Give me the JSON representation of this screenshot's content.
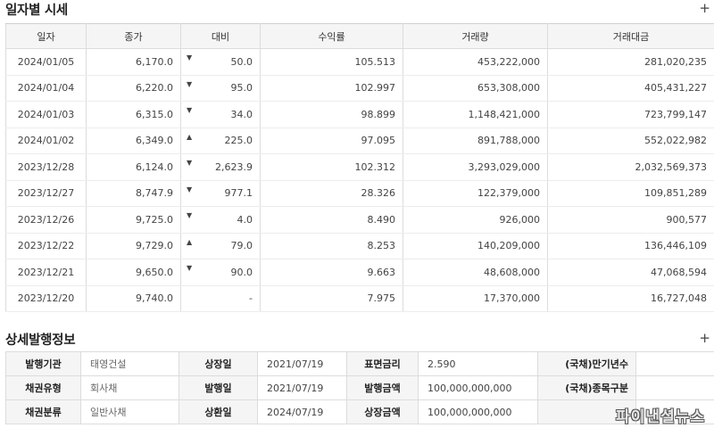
{
  "daily": {
    "title": "일자별 시세",
    "plus": "+",
    "columns": [
      "일자",
      "종가",
      "대비",
      "수익률",
      "거래량",
      "거래대금"
    ],
    "rows": [
      {
        "date": "2024/01/05",
        "close": "6,170.0",
        "dir": "down",
        "arrow": "▼",
        "change": "50.0",
        "yield": "105.513",
        "volume": "453,222,000",
        "amount": "281,020,235"
      },
      {
        "date": "2024/01/04",
        "close": "6,220.0",
        "dir": "down",
        "arrow": "▼",
        "change": "95.0",
        "yield": "102.997",
        "volume": "653,308,000",
        "amount": "405,431,227"
      },
      {
        "date": "2024/01/03",
        "close": "6,315.0",
        "dir": "down",
        "arrow": "▼",
        "change": "34.0",
        "yield": "98.899",
        "volume": "1,148,421,000",
        "amount": "723,799,147"
      },
      {
        "date": "2024/01/02",
        "close": "6,349.0",
        "dir": "up",
        "arrow": "▲",
        "change": "225.0",
        "yield": "97.095",
        "volume": "891,788,000",
        "amount": "552,022,982"
      },
      {
        "date": "2023/12/28",
        "close": "6,124.0",
        "dir": "down",
        "arrow": "▼",
        "change": "2,623.9",
        "yield": "102.312",
        "volume": "3,293,029,000",
        "amount": "2,032,569,373"
      },
      {
        "date": "2023/12/27",
        "close": "8,747.9",
        "dir": "down",
        "arrow": "▼",
        "change": "977.1",
        "yield": "28.326",
        "volume": "122,379,000",
        "amount": "109,851,289"
      },
      {
        "date": "2023/12/26",
        "close": "9,725.0",
        "dir": "down",
        "arrow": "▼",
        "change": "4.0",
        "yield": "8.490",
        "volume": "926,000",
        "amount": "900,577"
      },
      {
        "date": "2023/12/22",
        "close": "9,729.0",
        "dir": "up",
        "arrow": "▲",
        "change": "79.0",
        "yield": "8.253",
        "volume": "140,209,000",
        "amount": "136,446,109"
      },
      {
        "date": "2023/12/21",
        "close": "9,650.0",
        "dir": "down",
        "arrow": "▼",
        "change": "90.0",
        "yield": "9.663",
        "volume": "48,608,000",
        "amount": "47,068,594"
      },
      {
        "date": "2023/12/20",
        "close": "9,740.0",
        "dir": "flat",
        "arrow": "",
        "change": "-",
        "yield": "7.975",
        "volume": "17,370,000",
        "amount": "16,727,048"
      }
    ]
  },
  "detail": {
    "title": "상세발행정보",
    "plus": "+",
    "rows": [
      [
        {
          "label": "발행기관",
          "value": "태영건설"
        },
        {
          "label": "상장일",
          "value": "2021/07/19"
        },
        {
          "label": "표면금리",
          "value": "2.590"
        },
        {
          "label": "(국채)만기년수",
          "value": ""
        }
      ],
      [
        {
          "label": "채권유형",
          "value": "회사채"
        },
        {
          "label": "발행일",
          "value": "2021/07/19"
        },
        {
          "label": "발행금액",
          "value": "100,000,000,000"
        },
        {
          "label": "(국채)종목구분",
          "value": ""
        }
      ],
      [
        {
          "label": "채권분류",
          "value": "일반사채"
        },
        {
          "label": "상환일",
          "value": "2024/07/19"
        },
        {
          "label": "상장금액",
          "value": "100,000,000,000"
        },
        {
          "label": "-",
          "value": ""
        }
      ]
    ]
  },
  "watermark": "파이낸셜뉴스",
  "colors": {
    "down": "#1a73c8",
    "up": "#e24a3b",
    "header_bg": "#f5f5f5",
    "border": "#dcdcdc"
  }
}
